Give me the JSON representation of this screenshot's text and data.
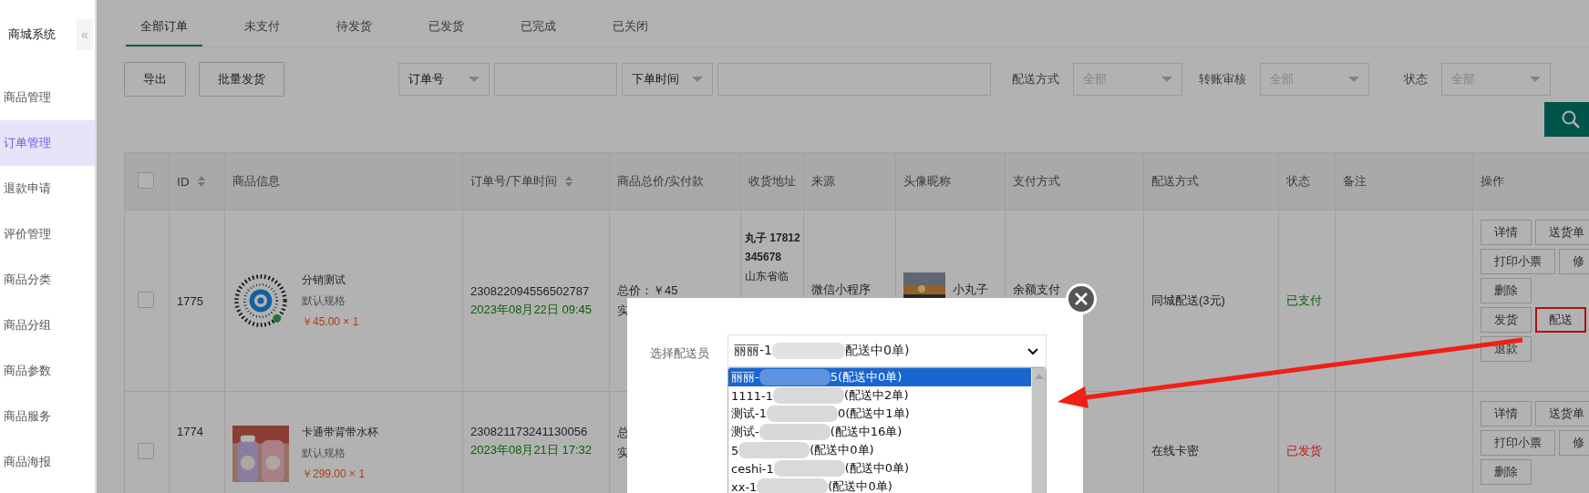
{
  "sidebar": {
    "title": "商城系统",
    "collapse": "«",
    "items": [
      {
        "label": "商品管理",
        "selected": false
      },
      {
        "label": "订单管理",
        "selected": true
      },
      {
        "label": "退款申请",
        "selected": false
      },
      {
        "label": "评价管理",
        "selected": false
      },
      {
        "label": "商品分类",
        "selected": false
      },
      {
        "label": "商品分组",
        "selected": false
      },
      {
        "label": "商品参数",
        "selected": false
      },
      {
        "label": "商品服务",
        "selected": false
      },
      {
        "label": "商品海报",
        "selected": false
      }
    ]
  },
  "tabs": [
    {
      "label": "全部订单",
      "selected": true
    },
    {
      "label": "未支付",
      "selected": false
    },
    {
      "label": "待发货",
      "selected": false
    },
    {
      "label": "已发货",
      "selected": false
    },
    {
      "label": "已完成",
      "selected": false
    },
    {
      "label": "已关闭",
      "selected": false
    }
  ],
  "toolbar": {
    "buttons": [
      "导出",
      "批量发货"
    ],
    "search_type": "订单号",
    "time_type": "下单时间",
    "filters": [
      {
        "label": "配送方式",
        "value": "全部"
      },
      {
        "label": "转账审核",
        "value": "全部"
      },
      {
        "label": "状态",
        "value": "全部"
      }
    ]
  },
  "table": {
    "columns": [
      {
        "label": "ID",
        "sortable": true
      },
      {
        "label": "商品信息",
        "sortable": false
      },
      {
        "label": "订单号/下单时间",
        "sortable": true
      },
      {
        "label": "商品总价/实付款",
        "sortable": false
      },
      {
        "label": "收货地址",
        "sortable": false
      },
      {
        "label": "来源",
        "sortable": false
      },
      {
        "label": "头像昵称",
        "sortable": false
      },
      {
        "label": "支付方式",
        "sortable": false
      },
      {
        "label": "配送方式",
        "sortable": false
      },
      {
        "label": "状态",
        "sortable": false
      },
      {
        "label": "备注",
        "sortable": false
      },
      {
        "label": "操作",
        "sortable": false
      }
    ],
    "rows": [
      {
        "id": "1775",
        "product": {
          "name": "分销测试",
          "spec": "默认规格",
          "price": "￥45.00 × 1"
        },
        "order_no": "230822094556502787",
        "time": "2023年08月22日 09:45",
        "total": "总价：￥45",
        "paid": "实",
        "checked": false,
        "address_name": "丸子 17812345678",
        "address": "山东省临",
        "source": "微信小程序",
        "nickname": "小丸子",
        "payment": "余额支付",
        "delivery": "同城配送(3元)",
        "status": {
          "text": "已支付",
          "kind": "paid"
        },
        "actions": [
          {
            "buttons": [
              {
                "label": "详情",
                "highlighted": false
              },
              {
                "label": "送货单",
                "highlighted": false
              }
            ]
          },
          {
            "buttons": [
              {
                "label": "打印小票",
                "highlighted": false
              },
              {
                "label": "修",
                "highlighted": false
              }
            ]
          },
          {
            "buttons": [
              {
                "label": "删除",
                "highlighted": false
              }
            ]
          },
          {
            "buttons": [
              {
                "label": "发货",
                "highlighted": false
              },
              {
                "label": "配送",
                "highlighted": true
              }
            ]
          },
          {
            "buttons": [
              {
                "label": "退款",
                "highlighted": false
              }
            ]
          }
        ]
      },
      {
        "id": "1774",
        "product": {
          "name": "卡通带背带水杯",
          "spec": "默认规格",
          "price": "￥299.00 × 1"
        },
        "order_no": "230821173241130056",
        "time": "2023年08月21日 17:32",
        "checked": false,
        "total": "总",
        "paid": "实",
        "delivery": "在线卡密",
        "status": {
          "text": "已发货",
          "kind": "shipped"
        },
        "actions": [
          {
            "buttons": [
              {
                "label": "详情",
                "highlighted": false
              },
              {
                "label": "送货单",
                "highlighted": false
              }
            ]
          },
          {
            "buttons": [
              {
                "label": "打印小票",
                "highlighted": false
              },
              {
                "label": "修",
                "highlighted": false
              }
            ]
          },
          {
            "buttons": [
              {
                "label": "删除",
                "highlighted": false
              }
            ]
          }
        ]
      }
    ],
    "all_checked": false
  },
  "dialog": {
    "label": "选择配送员",
    "select": {
      "prefix": "丽丽-1",
      "suffix": "配送中0单)"
    },
    "options": [
      {
        "prefix": "丽丽-",
        "suffix": "5(配送中0单)",
        "selected": true
      },
      {
        "prefix": "1111-1",
        "suffix": "(配送中2单)",
        "selected": false
      },
      {
        "prefix": "测试-1",
        "suffix": "0(配送中1单)",
        "selected": false
      },
      {
        "prefix": "测试-",
        "suffix": "(配送中16单)",
        "selected": false
      },
      {
        "prefix": "5",
        "suffix": "(配送中0单)",
        "selected": false
      },
      {
        "prefix": "ceshi-1",
        "suffix": "(配送中0单)",
        "selected": false
      },
      {
        "prefix": "xx-1",
        "suffix": "(配送中0单)",
        "selected": false
      }
    ]
  }
}
